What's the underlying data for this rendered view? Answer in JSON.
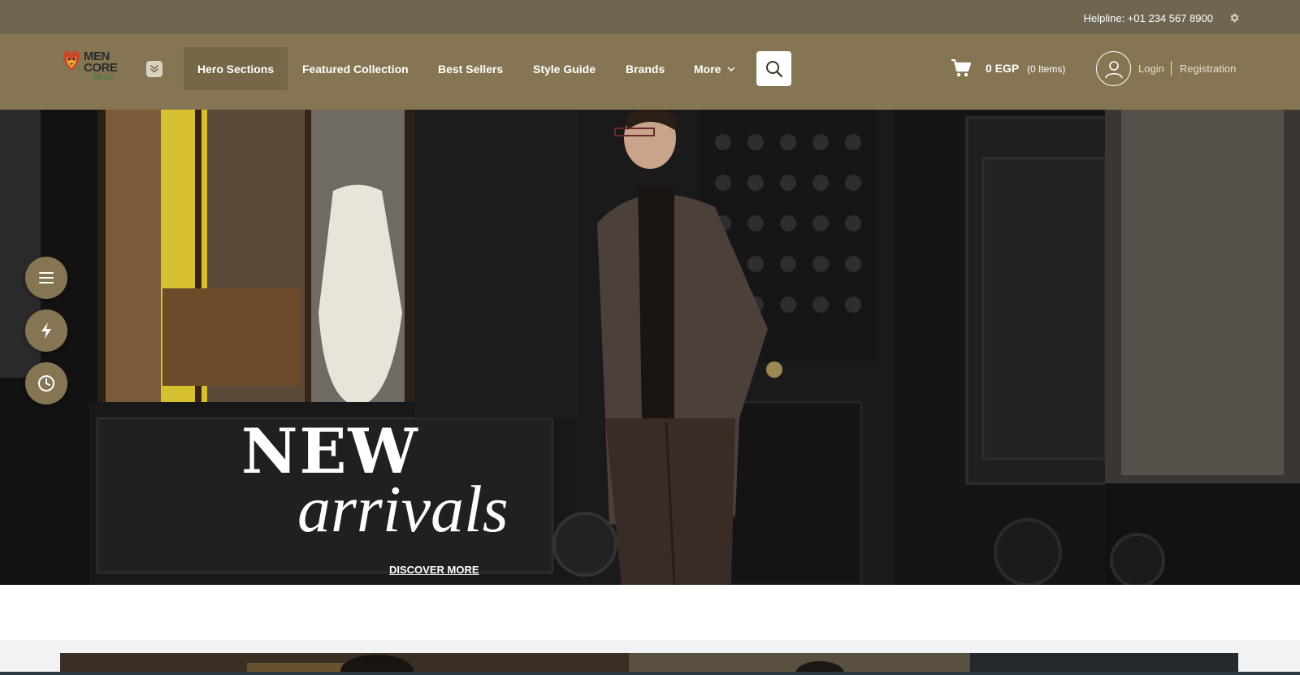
{
  "topbar": {
    "helpline": "Helpline: +01 234 567 8900",
    "settings_icon": "gear-icon"
  },
  "brand": {
    "logo_line1": "MEN",
    "logo_line2": "CORE",
    "logo_tag": "WeGo"
  },
  "nav": {
    "items": [
      {
        "label": "Hero Sections",
        "active": true
      },
      {
        "label": "Featured Collection"
      },
      {
        "label": "Best Sellers"
      },
      {
        "label": "Style Guide"
      },
      {
        "label": "Brands"
      },
      {
        "label": "More",
        "has_dropdown": true
      }
    ],
    "search_icon": "search-icon",
    "menu_toggle_icon": "chevron-double-down-icon"
  },
  "cart": {
    "total": "0 EGP",
    "items": "(0 Items)",
    "icon": "cart-icon"
  },
  "account": {
    "avatar_icon": "user-icon",
    "login": "Login",
    "registration": "Registration"
  },
  "hero": {
    "title_line1": "NEW",
    "title_line2": "arrivals",
    "cta": "DISCOVER MORE"
  },
  "floating_buttons": [
    {
      "icon": "menu-icon"
    },
    {
      "icon": "lightning-icon"
    },
    {
      "icon": "clock-icon"
    }
  ],
  "colors": {
    "topbar": "#6e6650",
    "navbar": "#857553",
    "nav_active": "#756748",
    "accent": "#857553"
  }
}
